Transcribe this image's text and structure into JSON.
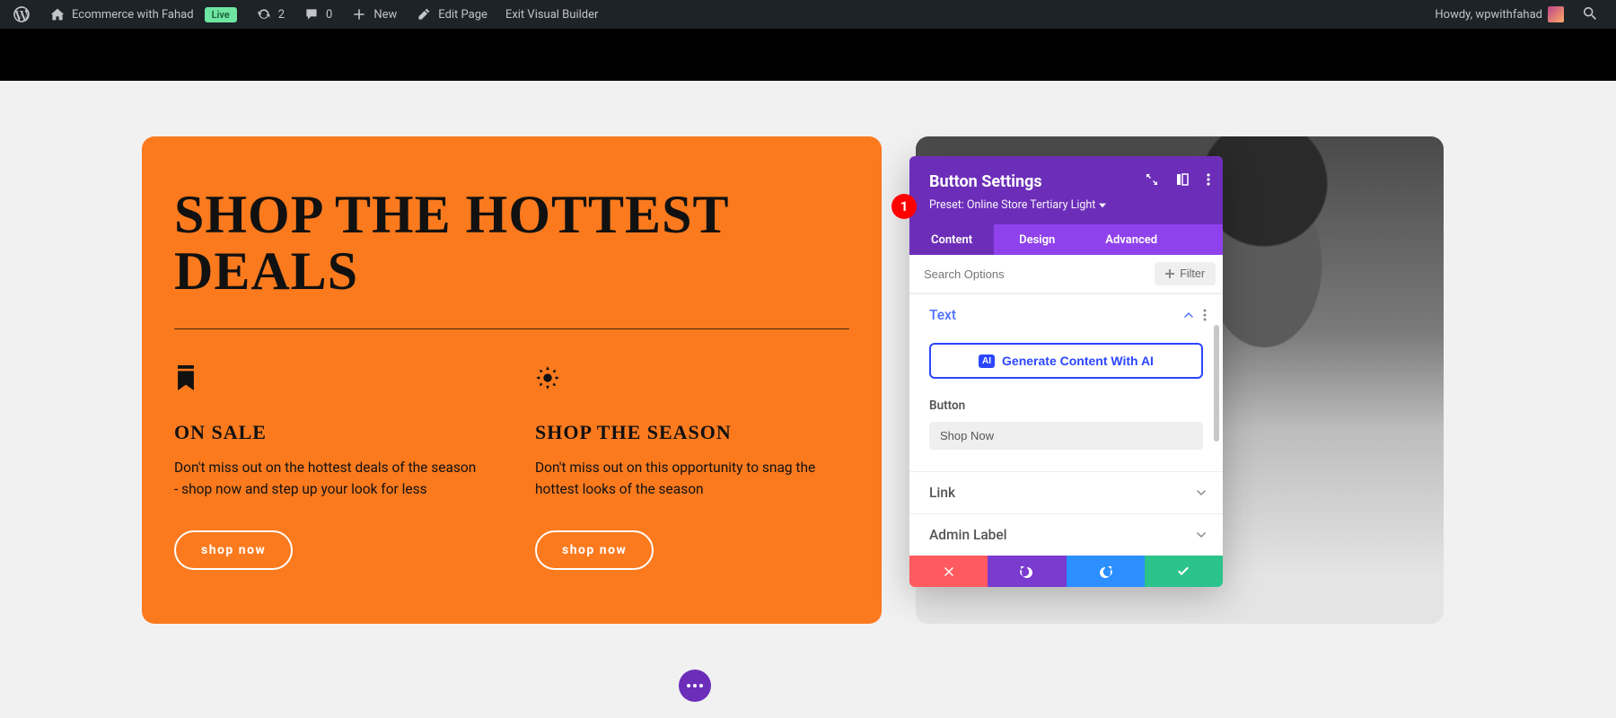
{
  "wpbar": {
    "site_name": "Ecommerce with Fahad",
    "live_label": "Live",
    "refresh_count": "2",
    "comment_count": "0",
    "new_label": "New",
    "edit_page_label": "Edit Page",
    "exit_vb_label": "Exit Visual Builder",
    "howdy_label": "Howdy, wpwithfahad"
  },
  "step_badge": "1",
  "orange": {
    "title_line1": "SHOP THE HOTTEST",
    "title_line2": "DEALS",
    "col1": {
      "heading": "ON SALE",
      "body": "Don't miss out on the hottest deals of the season - shop now and step up your look for less",
      "btn": "shop now"
    },
    "col2": {
      "heading": "SHOP THE SEASON",
      "body": "Don't miss out on this opportunity to snag the hottest looks of the season",
      "btn": "shop now"
    }
  },
  "panel": {
    "title": "Button Settings",
    "preset_label": "Preset: Online Store Tertiary Light",
    "tabs": {
      "content": "Content",
      "design": "Design",
      "advanced": "Advanced"
    },
    "search_placeholder": "Search Options",
    "filter_label": "Filter",
    "sections": {
      "text": {
        "label": "Text",
        "ai_btn": "Generate Content With AI",
        "field_label": "Button",
        "field_value": "Shop Now"
      },
      "link": {
        "label": "Link"
      },
      "admin": {
        "label": "Admin Label"
      }
    }
  }
}
